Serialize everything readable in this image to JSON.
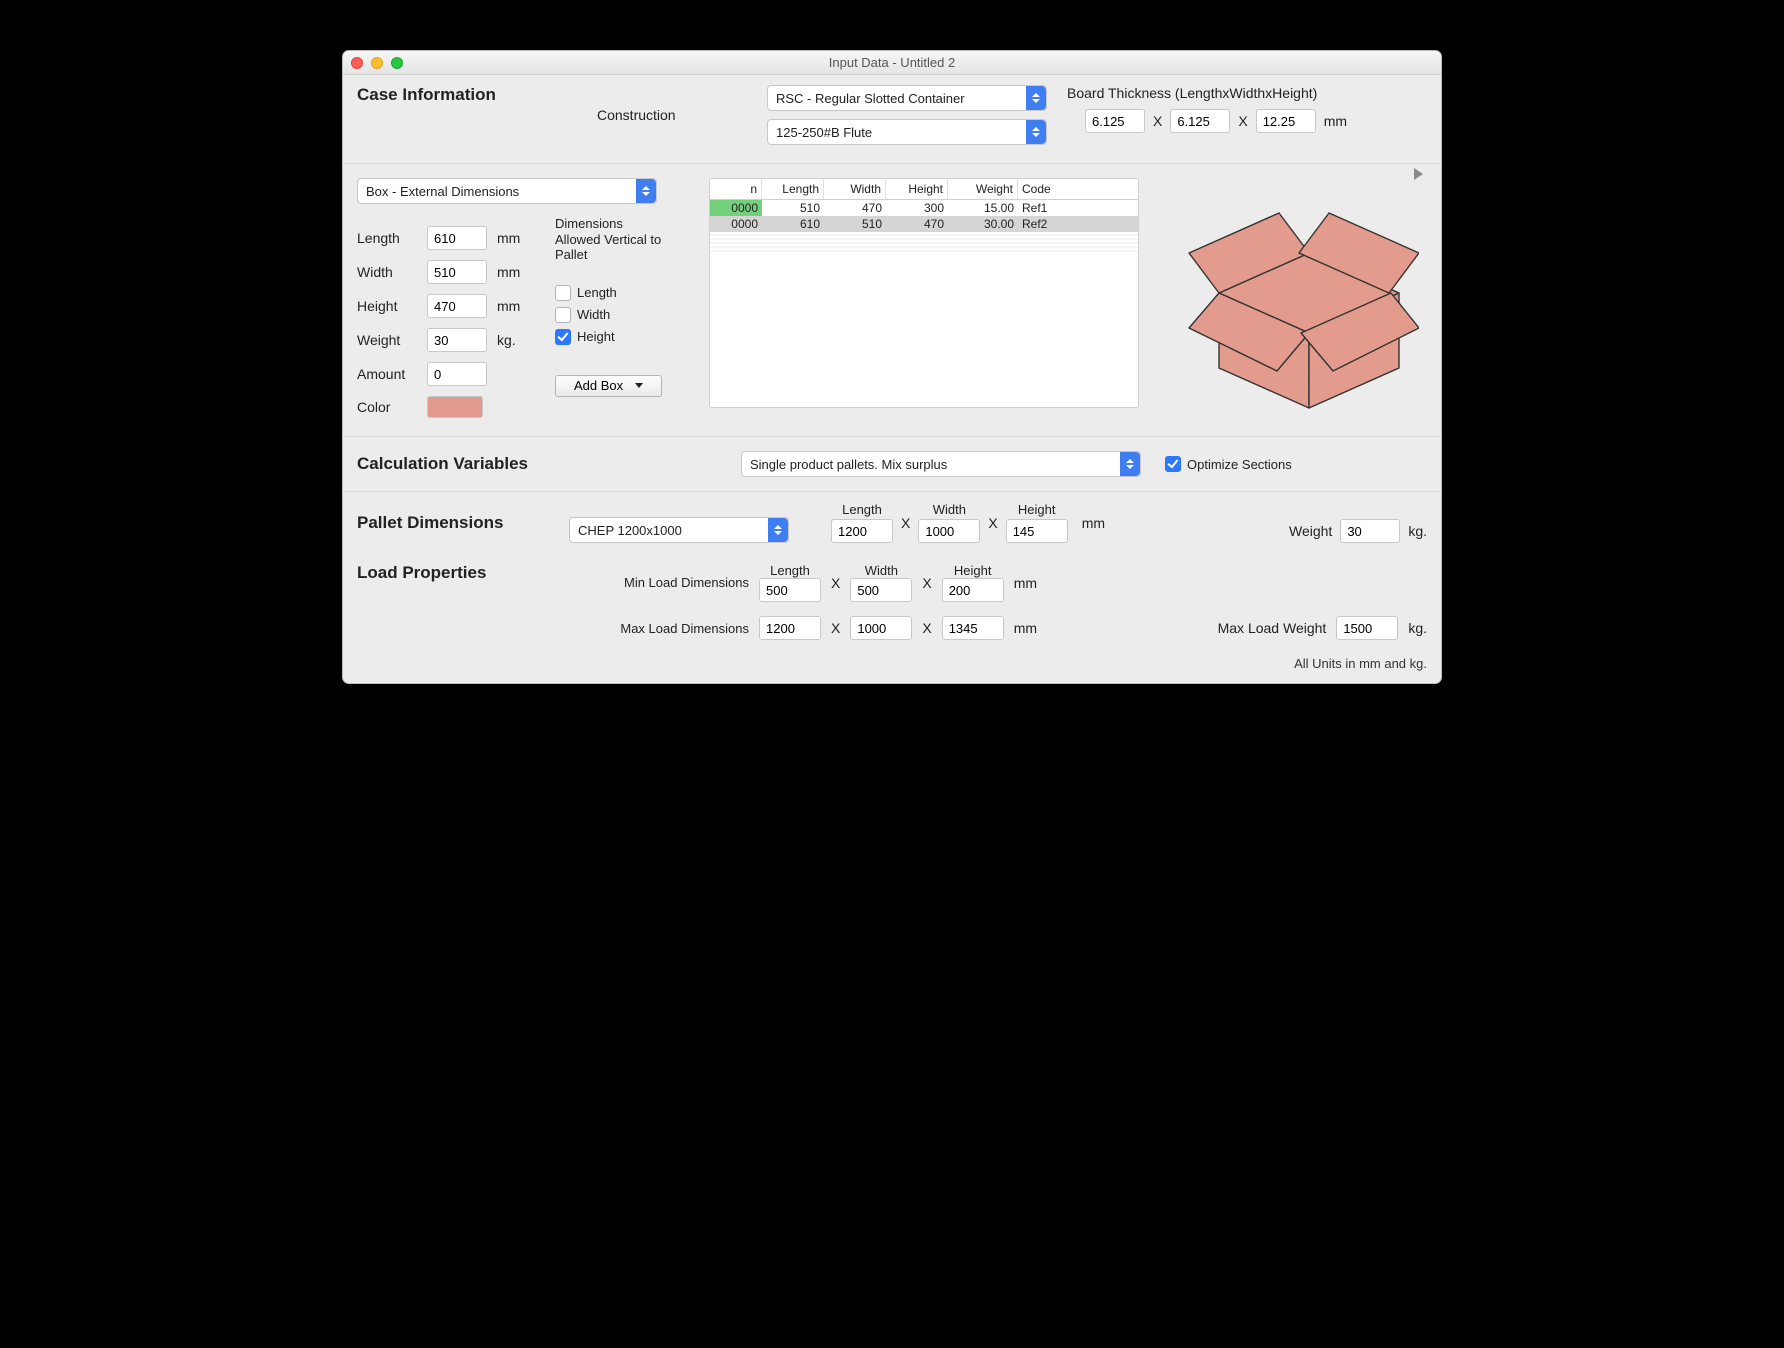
{
  "window": {
    "title": "Input Data - Untitled 2"
  },
  "case_info": {
    "heading": "Case Information",
    "construction_label": "Construction",
    "construction_value": "RSC - Regular Slotted Container",
    "flute_value": "125-250#B Flute",
    "board_thickness_label": "Board Thickness (LengthxWidthxHeight)",
    "bt_l": "6.125",
    "bt_w": "6.125",
    "bt_h": "12.25",
    "x": "X",
    "unit": "mm"
  },
  "box": {
    "dimensions_dropdown": "Box - External Dimensions",
    "labels": {
      "length": "Length",
      "width": "Width",
      "height": "Height",
      "weight": "Weight",
      "amount": "Amount",
      "color": "Color"
    },
    "values": {
      "length": "610",
      "width": "510",
      "height": "470",
      "weight": "30",
      "amount": "0"
    },
    "unit_mm": "mm",
    "unit_kg": "kg.",
    "dims_allowed_heading": "Dimensions Allowed Vertical to Pallet",
    "chk_length": "Length",
    "chk_width": "Width",
    "chk_height": "Height",
    "add_box": "Add Box",
    "color_hex": "#e29b8c"
  },
  "table": {
    "headers": [
      "n",
      "Length",
      "Width",
      "Height",
      "Weight",
      "Code"
    ],
    "rows": [
      {
        "n": "0000",
        "length": "510",
        "width": "470",
        "height": "300",
        "weight": "15.00",
        "code": "Ref1",
        "sel": true
      },
      {
        "n": "0000",
        "length": "610",
        "width": "510",
        "height": "470",
        "weight": "30.00",
        "code": "Ref2",
        "sel": false
      }
    ]
  },
  "calc": {
    "heading": "Calculation Variables",
    "mode": "Single product pallets. Mix surplus",
    "optimize_label": "Optimize Sections"
  },
  "pallet": {
    "heading": "Pallet Dimensions",
    "type": "CHEP 1200x1000",
    "length_hdr": "Length",
    "width_hdr": "Width",
    "height_hdr": "Height",
    "length": "1200",
    "width": "1000",
    "height": "145",
    "unit": "mm",
    "x": "X",
    "weight_label": "Weight",
    "weight": "30",
    "weight_unit": "kg."
  },
  "load": {
    "heading": "Load Properties",
    "min_label": "Min Load Dimensions",
    "max_label": "Max Load Dimensions",
    "length_hdr": "Length",
    "width_hdr": "Width",
    "height_hdr": "Height",
    "min_l": "500",
    "min_w": "500",
    "min_h": "200",
    "max_l": "1200",
    "max_w": "1000",
    "max_h": "1345",
    "unit": "mm",
    "x": "X",
    "max_weight_label": "Max Load Weight",
    "max_weight": "1500",
    "weight_unit": "kg."
  },
  "footer": {
    "units_note": "All Units in mm and kg."
  }
}
